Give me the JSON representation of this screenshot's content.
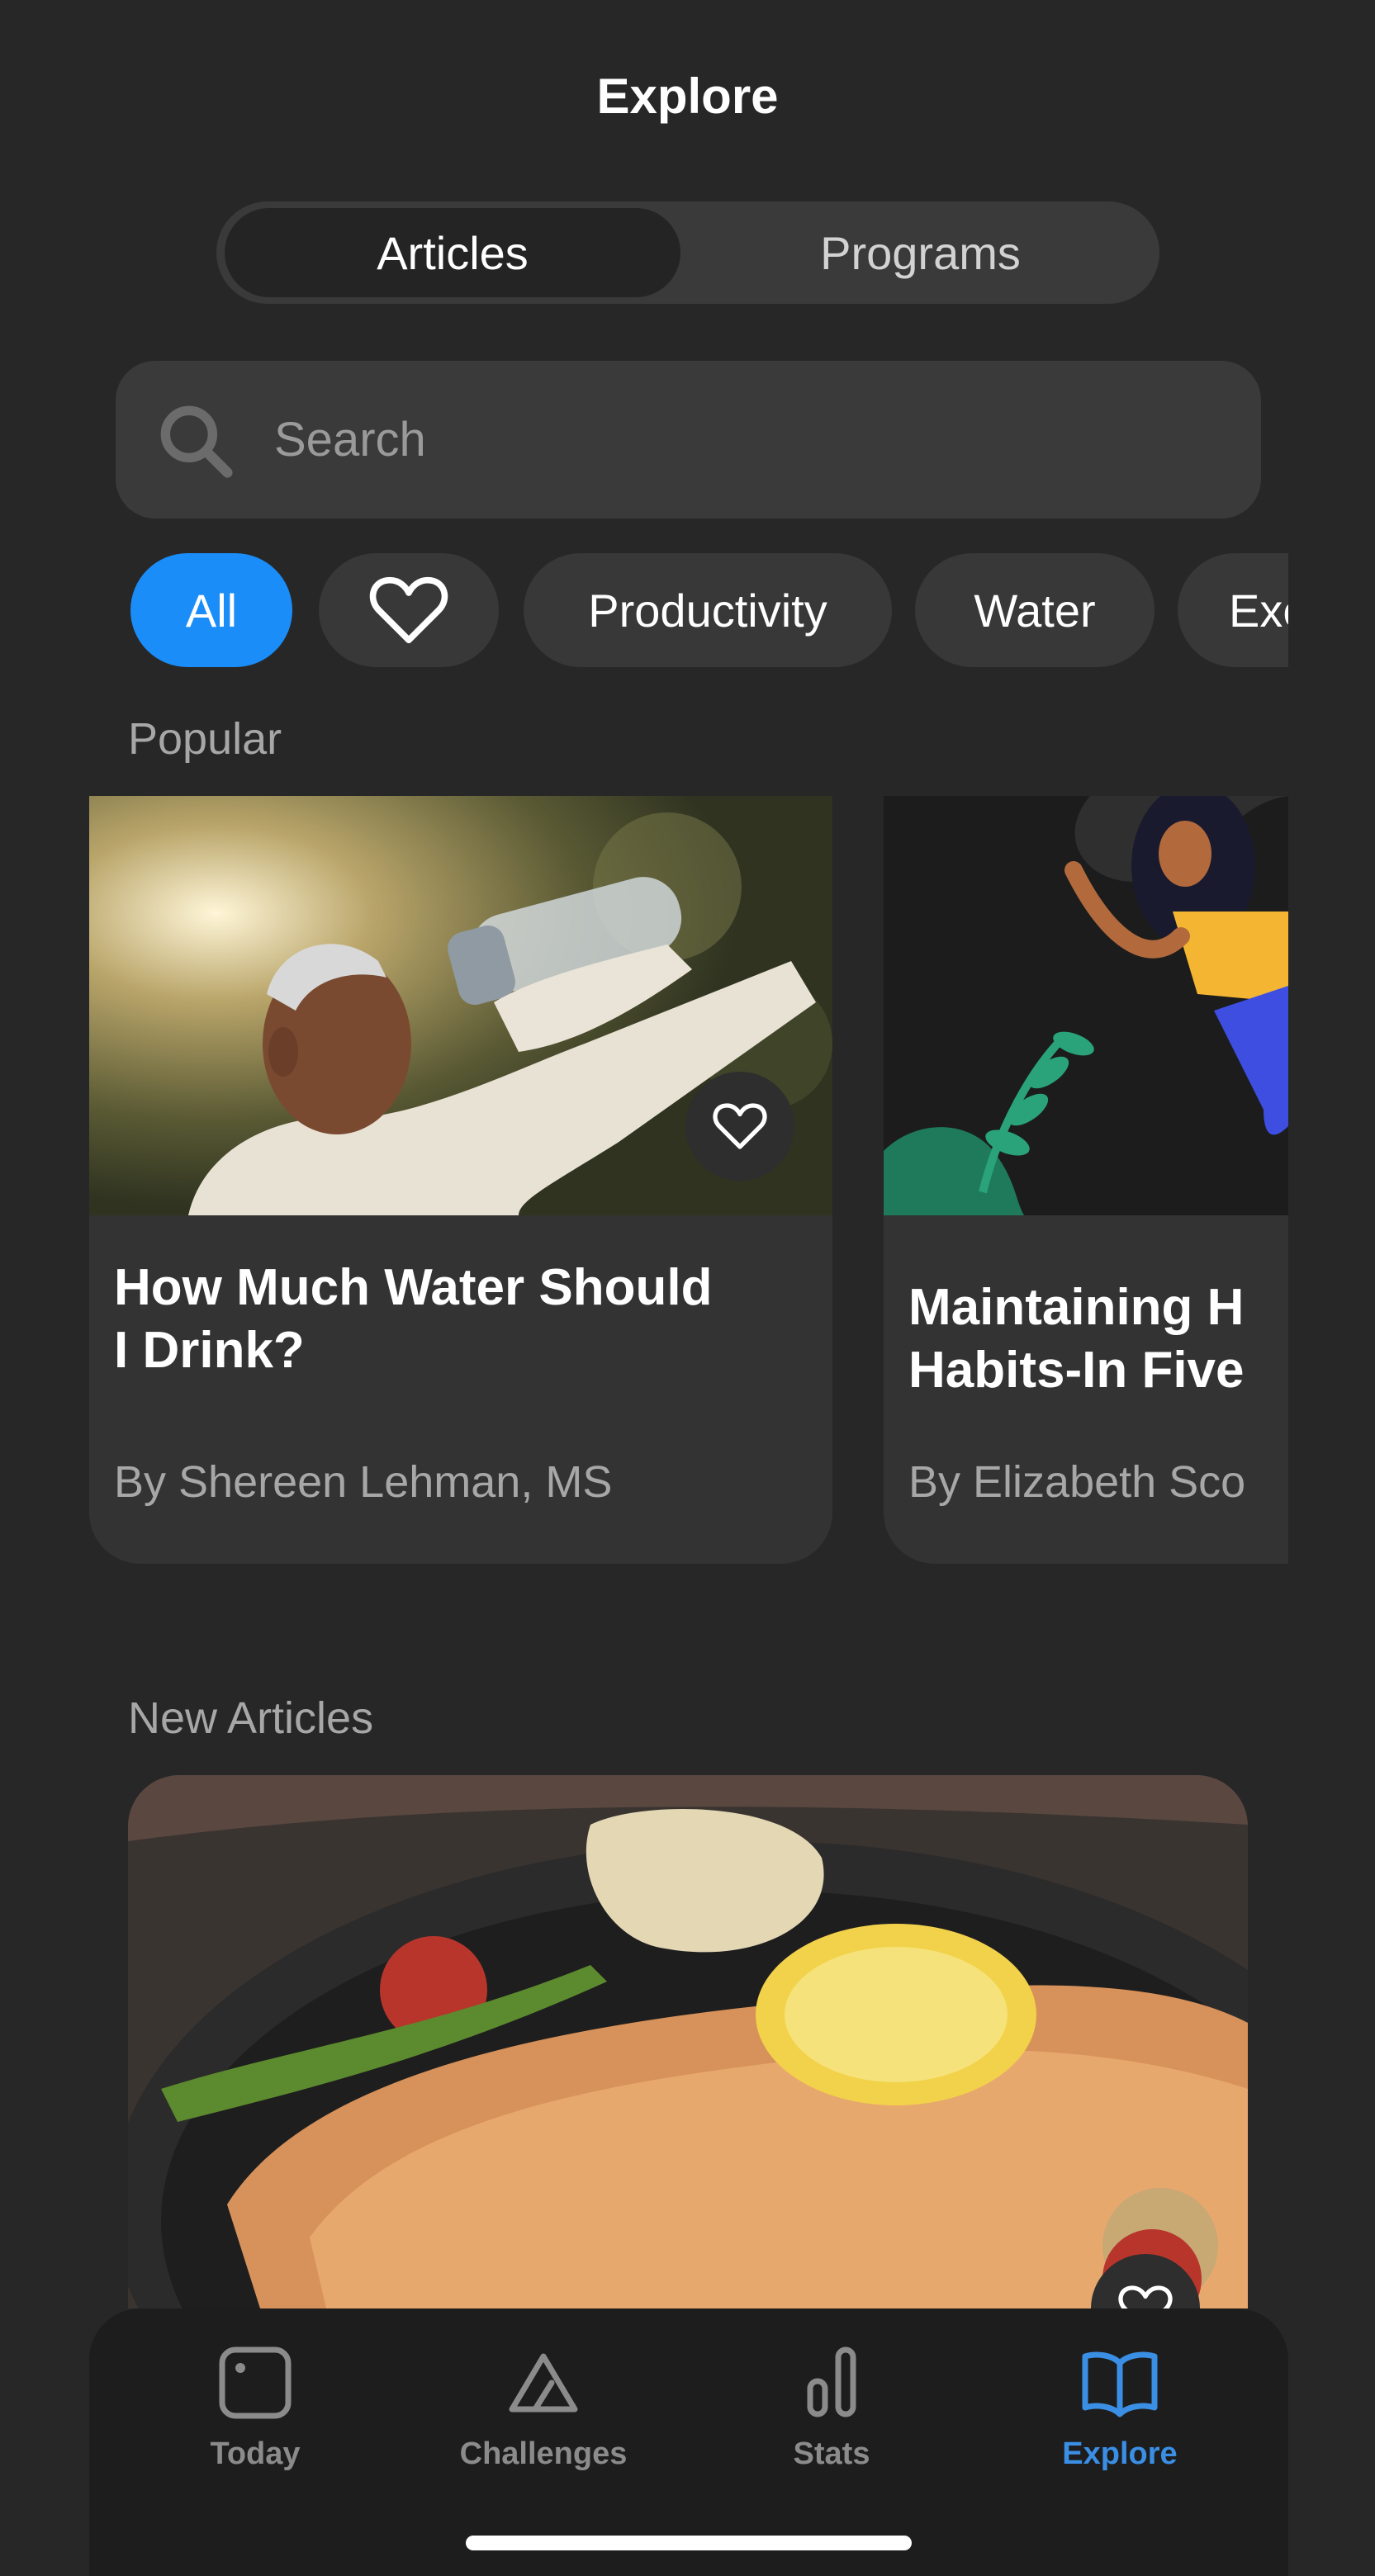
{
  "header": {
    "title": "Explore"
  },
  "segmented": {
    "active": "Articles",
    "inactive": "Programs"
  },
  "search": {
    "placeholder": "Search",
    "icon": "search-icon"
  },
  "filters": [
    {
      "label": "All",
      "active": true
    },
    {
      "icon": "heart-icon"
    },
    {
      "label": "Productivity"
    },
    {
      "label": "Water"
    },
    {
      "label": "Exe"
    }
  ],
  "sections": {
    "popular": "Popular",
    "new_articles": "New Articles"
  },
  "popular_cards": [
    {
      "title": "How Much Water Should\nI Drink?",
      "author": "By Shereen Lehman, MS",
      "image": "man-drinking-water-photo",
      "favorite_icon": "heart-icon"
    },
    {
      "title": "Maintaining H\nHabits-In Five",
      "author": "By Elizabeth Sco",
      "image": "woman-exercise-illustration"
    }
  ],
  "new_articles": [
    {
      "image": "salmon-lemon-dish-photo",
      "favorite_icon": "heart-icon"
    }
  ],
  "tabbar": {
    "items": [
      {
        "label": "Today",
        "icon": "today-square-icon",
        "active": false
      },
      {
        "label": "Challenges",
        "icon": "triangle-icon",
        "active": false
      },
      {
        "label": "Stats",
        "icon": "bar-chart-icon",
        "active": false
      },
      {
        "label": "Explore",
        "icon": "open-book-icon",
        "active": true
      }
    ]
  },
  "colors": {
    "background": "#272727",
    "accent": "#1a8df8",
    "card": "#333333",
    "tabbar": "#1d1d1d",
    "explore_active": "#3a8fe5"
  }
}
